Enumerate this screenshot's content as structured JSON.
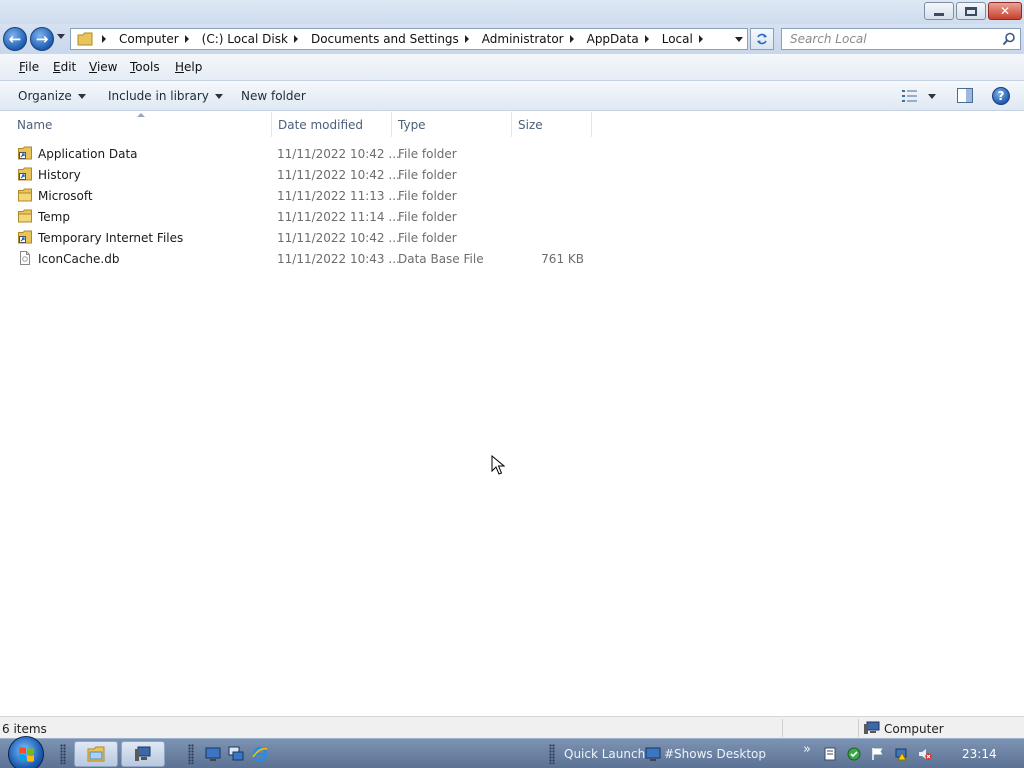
{
  "window": {
    "controls": {
      "minimize": "minimize",
      "maximize": "restore",
      "close": "close"
    }
  },
  "address": {
    "crumbs": [
      "Computer",
      "(C:) Local Disk",
      "Documents and Settings",
      "Administrator",
      "AppData",
      "Local"
    ],
    "search_placeholder": "Search Local"
  },
  "menu": {
    "items": [
      {
        "key": "F",
        "rest": "ile"
      },
      {
        "key": "E",
        "rest": "dit"
      },
      {
        "key": "V",
        "rest": "iew"
      },
      {
        "key": "T",
        "rest": "ools"
      },
      {
        "key": "H",
        "rest": "elp"
      }
    ]
  },
  "commands": {
    "organize": "Organize",
    "include_in_library": "Include in library",
    "new_folder": "New folder"
  },
  "columns": {
    "name": "Name",
    "date": "Date modified",
    "type": "Type",
    "size": "Size"
  },
  "files": [
    {
      "name": "Application Data",
      "date": "11/11/2022 10:42 ...",
      "type": "File folder",
      "size": "",
      "icon": "folder-shortcut-icon"
    },
    {
      "name": "History",
      "date": "11/11/2022 10:42 ...",
      "type": "File folder",
      "size": "",
      "icon": "folder-shortcut-icon"
    },
    {
      "name": "Microsoft",
      "date": "11/11/2022 11:13 ...",
      "type": "File folder",
      "size": "",
      "icon": "folder-icon"
    },
    {
      "name": "Temp",
      "date": "11/11/2022 11:14 ...",
      "type": "File folder",
      "size": "",
      "icon": "folder-icon"
    },
    {
      "name": "Temporary Internet Files",
      "date": "11/11/2022 10:42 ...",
      "type": "File folder",
      "size": "",
      "icon": "folder-shortcut-icon"
    },
    {
      "name": "IconCache.db",
      "date": "11/11/2022 10:43 ...",
      "type": "Data Base File",
      "size": "761 KB",
      "icon": "file-icon"
    }
  ],
  "status": {
    "item_count": "6 items",
    "location": "Computer"
  },
  "taskbar": {
    "quick_launch": "Quick Launch",
    "shows_desktop": "#Shows Desktop",
    "chevron": "»",
    "clock": "23:14"
  },
  "colors": {
    "accent": "#1d5db1",
    "taskbar": "#5b7294",
    "toolbar": "#dfe8f3"
  }
}
